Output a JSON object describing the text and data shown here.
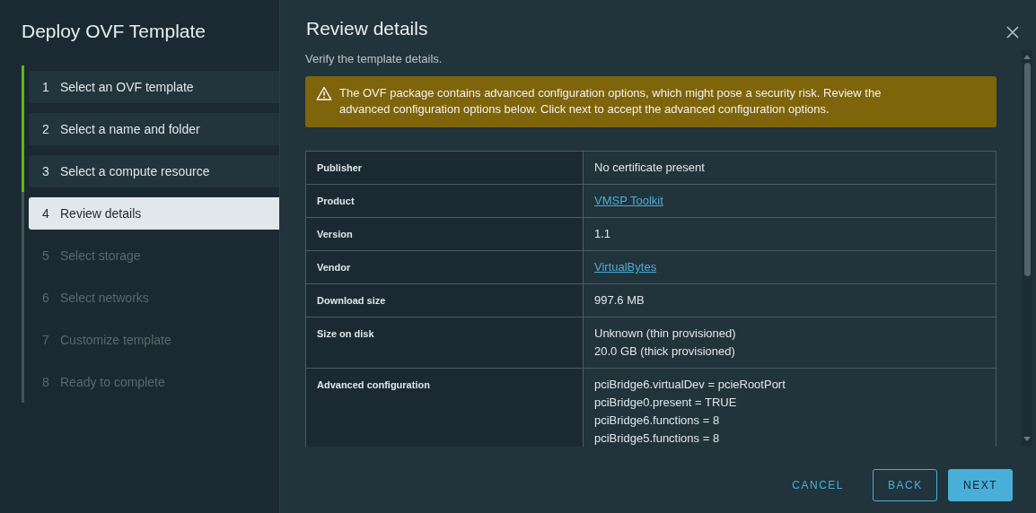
{
  "sidebar": {
    "title": "Deploy OVF Template",
    "steps": [
      {
        "number": "1",
        "label": "Select an OVF template",
        "completed": true,
        "selected": false
      },
      {
        "number": "2",
        "label": "Select a name and folder",
        "completed": true,
        "selected": false
      },
      {
        "number": "3",
        "label": "Select a compute resource",
        "completed": true,
        "selected": false
      },
      {
        "number": "4",
        "label": "Review details",
        "completed": false,
        "selected": true
      },
      {
        "number": "5",
        "label": "Select storage",
        "completed": false,
        "selected": false
      },
      {
        "number": "6",
        "label": "Select networks",
        "completed": false,
        "selected": false
      },
      {
        "number": "7",
        "label": "Customize template",
        "completed": false,
        "selected": false
      },
      {
        "number": "8",
        "label": "Ready to complete",
        "completed": false,
        "selected": false
      }
    ]
  },
  "main": {
    "title": "Review details",
    "subtitle": "Verify the template details.",
    "warning": "The OVF package contains advanced configuration options, which might pose a security risk. Review the advanced configuration options below. Click next to accept the advanced configuration options.",
    "details": [
      {
        "label": "Publisher",
        "kind": "text",
        "lines": [
          "No certificate present"
        ]
      },
      {
        "label": "Product",
        "kind": "link",
        "lines": [
          "VMSP Toolkit"
        ]
      },
      {
        "label": "Version",
        "kind": "text",
        "lines": [
          "1.1"
        ]
      },
      {
        "label": "Vendor",
        "kind": "link",
        "lines": [
          "VirtualBytes"
        ]
      },
      {
        "label": "Download size",
        "kind": "text",
        "lines": [
          "997.6 MB"
        ]
      },
      {
        "label": "Size on disk",
        "kind": "text",
        "lines": [
          "Unknown (thin provisioned)",
          "20.0 GB (thick provisioned)"
        ]
      },
      {
        "label": "Advanced configuration",
        "kind": "text",
        "lines": [
          "pciBridge6.virtualDev = pcieRootPort",
          "pciBridge0.present = TRUE",
          "pciBridge6.functions = 8",
          "pciBridge5.functions = 8"
        ]
      }
    ]
  },
  "buttons": [
    {
      "label": "CANCEL",
      "kind": "flat"
    },
    {
      "label": "BACK",
      "kind": "outline"
    },
    {
      "label": "NEXT",
      "kind": "primary"
    }
  ]
}
